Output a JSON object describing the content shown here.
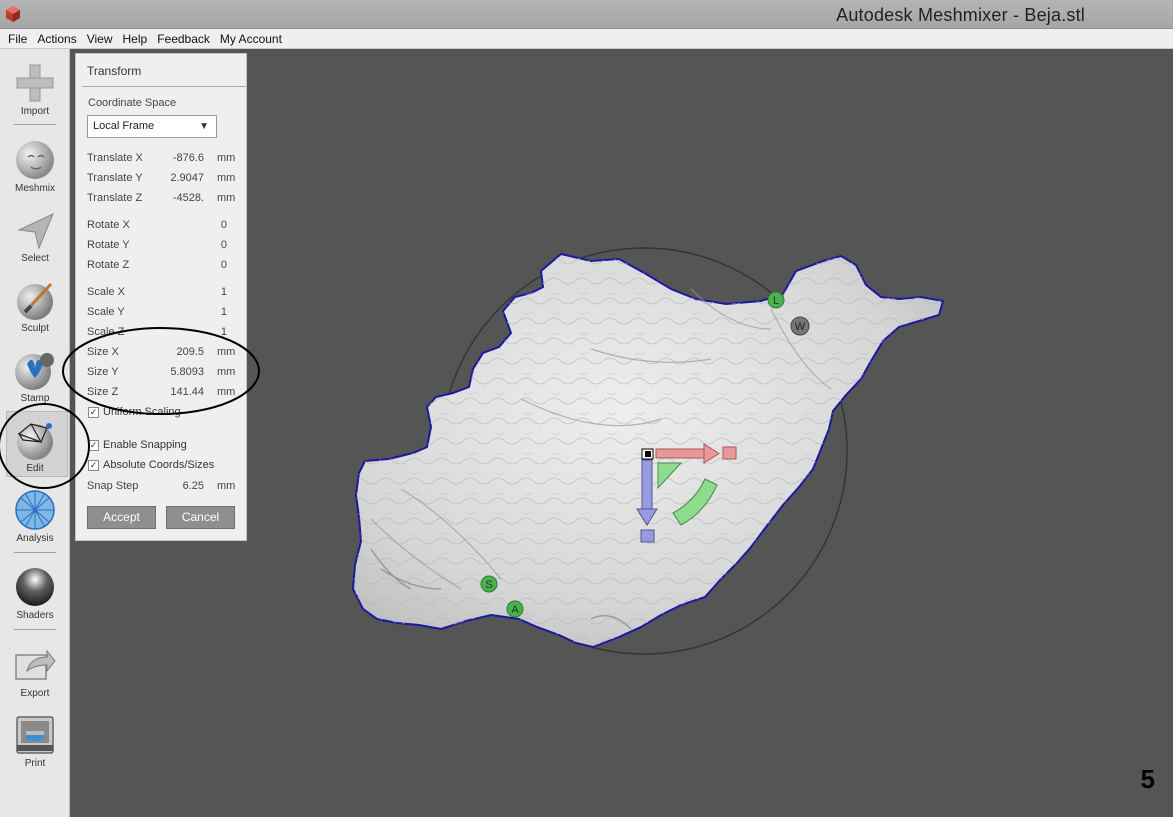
{
  "window": {
    "title": "Autodesk Meshmixer - Beja.stl"
  },
  "menu": [
    "File",
    "Actions",
    "View",
    "Help",
    "Feedback",
    "My Account"
  ],
  "toolbar": {
    "tools": [
      {
        "label": "Import",
        "icon": "plus-icon"
      },
      {
        "label": "Meshmix",
        "icon": "face-sphere-icon"
      },
      {
        "label": "Select",
        "icon": "cursor-arrow-icon"
      },
      {
        "label": "Sculpt",
        "icon": "brush-sphere-icon"
      },
      {
        "label": "Stamp",
        "icon": "fleur-stamp-icon"
      },
      {
        "label": "Edit",
        "icon": "wireframe-sphere-icon",
        "active": true
      },
      {
        "label": "Analysis",
        "icon": "mesh-sphere-icon"
      },
      {
        "label": "Shaders",
        "icon": "chrome-sphere-icon"
      },
      {
        "label": "Export",
        "icon": "export-arrow-icon"
      },
      {
        "label": "Print",
        "icon": "printer-icon"
      }
    ]
  },
  "panel": {
    "title": "Transform",
    "coordinate_space_label": "Coordinate Space",
    "coordinate_space_value": "Local Frame",
    "translate": [
      {
        "label": "Translate X",
        "value": "-876.6",
        "unit": "mm"
      },
      {
        "label": "Translate Y",
        "value": "2.9047",
        "unit": "mm"
      },
      {
        "label": "Translate Z",
        "value": "-4528.",
        "unit": "mm"
      }
    ],
    "rotate": [
      {
        "label": "Rotate X",
        "value": "0"
      },
      {
        "label": "Rotate Y",
        "value": "0"
      },
      {
        "label": "Rotate Z",
        "value": "0"
      }
    ],
    "scale": [
      {
        "label": "Scale X",
        "value": "1"
      },
      {
        "label": "Scale Y",
        "value": "1"
      },
      {
        "label": "Scale Z",
        "value": "1"
      }
    ],
    "size": [
      {
        "label": "Size X",
        "value": "209.5",
        "unit": "mm"
      },
      {
        "label": "Size Y",
        "value": "5.8093",
        "unit": "mm"
      },
      {
        "label": "Size Z",
        "value": "141.44",
        "unit": "mm"
      }
    ],
    "uniform_scaling": {
      "label": "Uniform Scaling",
      "checked": true
    },
    "enable_snapping": {
      "label": "Enable Snapping",
      "checked": true
    },
    "absolute_coords": {
      "label": "Absolute Coords/Sizes",
      "checked": true
    },
    "snap_step": {
      "label": "Snap Step",
      "value": "6.25",
      "unit": "mm"
    },
    "accept_label": "Accept",
    "cancel_label": "Cancel"
  },
  "viewport": {
    "markers": [
      "L",
      "W",
      "S",
      "A"
    ],
    "page_number": "5"
  },
  "colors": {
    "viewport_bg": "#555555",
    "mesh_edge": "#1a1aa0",
    "gizmo_x": "#e89a9a",
    "gizmo_y": "#9a9ae2",
    "gizmo_rot": "#8fdc8f",
    "marker": "#4caf50"
  }
}
